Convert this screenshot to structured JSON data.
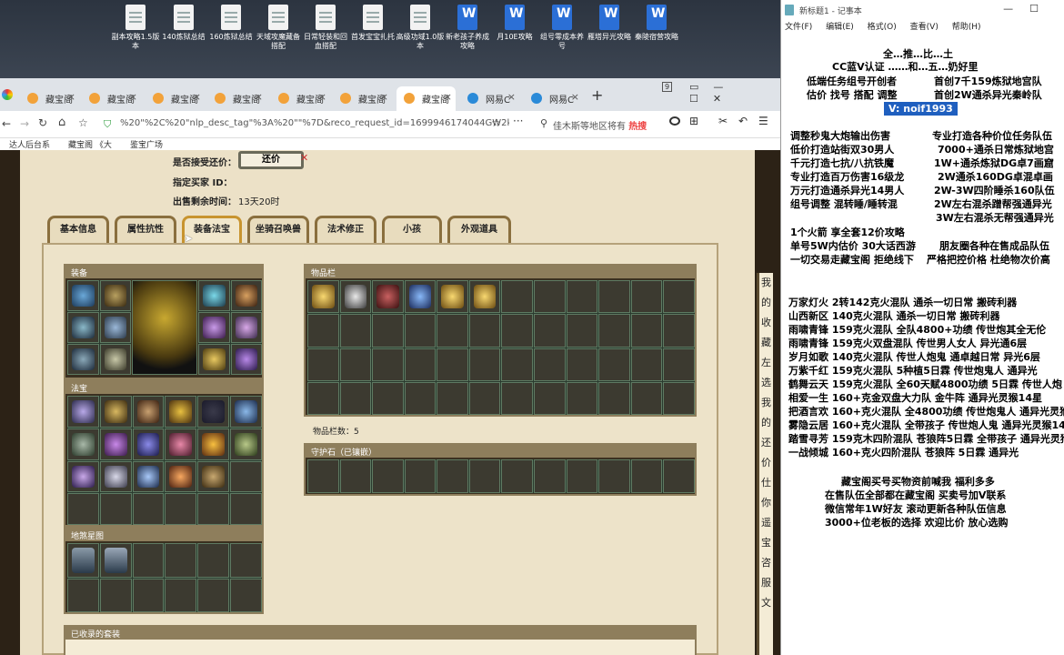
{
  "desktop": {
    "icons": [
      {
        "label": "副本攻略1.5版本",
        "type": "doc"
      },
      {
        "label": "140炼狱总结",
        "type": "doc"
      },
      {
        "label": "160炼狱总结",
        "type": "doc"
      },
      {
        "label": "天域攻魔藏备搭配",
        "type": "doc"
      },
      {
        "label": "日常轻装和回血搭配",
        "type": "doc"
      },
      {
        "label": "首发宝宝扎托",
        "type": "doc"
      },
      {
        "label": "高级功域1.0版本",
        "type": "doc"
      },
      {
        "label": "新老孩子养成攻略",
        "type": "word"
      },
      {
        "label": "月10E攻略",
        "type": "word"
      },
      {
        "label": "组号零成本养号",
        "type": "word"
      },
      {
        "label": "雁塔异光攻略",
        "type": "word"
      },
      {
        "label": "秦陵宿营攻略",
        "type": "word"
      }
    ]
  },
  "browser": {
    "tabs": [
      {
        "label": "藏宝阁"
      },
      {
        "label": "藏宝阁"
      },
      {
        "label": "藏宝阁"
      },
      {
        "label": "藏宝阁"
      },
      {
        "label": "藏宝阁"
      },
      {
        "label": "藏宝阁"
      },
      {
        "label": "藏宝阁",
        "active": true
      },
      {
        "label": "网易C"
      },
      {
        "label": "网易C"
      }
    ],
    "tab_count": "9",
    "url": "%20\"%2C%20\"nlp_desc_tag\"%3A%20\"\"%7D&reco_request_id=1699946174044GW2kd",
    "search_text": "佳木斯等地区将有",
    "search_hot": "热搜",
    "bookmarks": [
      "达人后台系",
      "藏宝阁 《大",
      "鉴宝广场"
    ]
  },
  "game": {
    "accept_price_label": "是否接受还价：",
    "accept_price_button": "还价",
    "buyer_id_label": "指定买家 ID：",
    "time_left_label": "出售剩余时间：",
    "time_left_value": "13天20时",
    "tabs": [
      "基本信息",
      "属性抗性",
      "装备法宝",
      "坐骑召唤兽",
      "法术修正",
      "小孩",
      "外观道具"
    ],
    "active_tab": "装备法宝",
    "sections": {
      "equipment": "装备",
      "fabao": "法宝",
      "dishafabao": "地煞星图",
      "inventory": "物品栏",
      "guardian": "守护石（已镶嵌）",
      "collected": "已收录的套装"
    },
    "item_count_label": "物品栏数：5",
    "right_strip": [
      "我",
      "的",
      "收",
      "藏",
      "左",
      "选",
      "我",
      "的",
      "还",
      "价",
      "仕",
      "你",
      "遥",
      "宝",
      "咨",
      "服",
      "文"
    ]
  },
  "notepad": {
    "title": "新标题1 - 记事本",
    "menu": [
      "文件(F)",
      "编辑(E)",
      "格式(O)",
      "查看(V)",
      "帮助(H)"
    ],
    "lines": [
      {
        "text": "全…推…比…土",
        "selected": false
      },
      {
        "text": "CC蓝V认证 ……和…五…奶好里",
        "selected": false
      },
      {
        "text": "低端任务组号开创者",
        "selected": false
      },
      {
        "text": "首创7千159炼狱地宫队",
        "selected": false
      },
      {
        "text": "估价 找号 搭配 调整",
        "selected": false
      },
      {
        "text": "首创2W通杀异光秦岭队",
        "selected": false
      },
      {
        "text": "V: noif1993",
        "selected": true
      },
      {
        "text": "调整秒鬼大炮输出伤害",
        "selected": false
      },
      {
        "text": "专业打造各种价位任务队伍",
        "selected": false
      },
      {
        "text": "低价打造站街双30男人",
        "selected": false
      },
      {
        "text": "7000+通杀日常炼狱地宫",
        "selected": false
      },
      {
        "text": "千元打造七抗/八抗铁魔",
        "selected": false
      },
      {
        "text": "1W+通杀炼狱DG卓7画窟",
        "selected": false
      },
      {
        "text": "专业打造百万伤害16级龙",
        "selected": false
      },
      {
        "text": "2W通杀160DG卓混卓画",
        "selected": false
      },
      {
        "text": "万元打造通杀异光14男人",
        "selected": false
      },
      {
        "text": "2W-3W四阶睡杀160队伍",
        "selected": false
      },
      {
        "text": "组号调整 混转睡/睡转混",
        "selected": false
      },
      {
        "text": "2W左右混杀蹭帮强通异光",
        "selected": false
      },
      {
        "text": "3W左右混杀无帮强通异光",
        "selected": false
      },
      {
        "text": "1个火箭 享全套12价攻略",
        "selected": false
      },
      {
        "text": "单号5W内估价 30大话西游",
        "selected": false
      },
      {
        "text": "朋友圈各种在售成品队伍",
        "selected": false
      },
      {
        "text": "一切交易走藏宝阁 拒绝线下",
        "selected": false
      },
      {
        "text": "严格把控价格 杜绝物次价高",
        "selected": false
      },
      {
        "text": "万家灯火 2转142克火混队 通杀一切日常 搬砖利器",
        "selected": false
      },
      {
        "text": "山西新区 140克火混队 通杀一切日常 搬砖利器",
        "selected": false
      },
      {
        "text": "雨啸青锋 159克火混队 全队4800+功绩 传世炮其全无伦",
        "selected": false
      },
      {
        "text": "雨啸青锋 159克火双盘混队 传世男人女人 异光通6层",
        "selected": false
      },
      {
        "text": "岁月如歌 140克火混队 传世人炮鬼 通卓越日常 异光6层",
        "selected": false
      },
      {
        "text": "万紫千红 159克火混队 5种植5日霖 传世炮鬼人 通异光",
        "selected": false
      },
      {
        "text": "鹤舞云天 159克火混队 全60天赋4800功绩 5日霖 传世人炮",
        "selected": false
      },
      {
        "text": "相爱一生 160+克金双盘大力队 金牛阵 通异光灵猴14星",
        "selected": false
      },
      {
        "text": "把酒言欢 160+克火混队 全4800功绩 传世炮鬼人 通异光灵猴",
        "selected": false
      },
      {
        "text": "雾隐云居 160+克火混队 全带孩子 传世炮人鬼 通异光灵猴14",
        "selected": false
      },
      {
        "text": "踏雪寻芳 159克木四阶混队 苍狼阵5日霖 全带孩子 通异光灵猴",
        "selected": false
      },
      {
        "text": "一战倾城 160+克火四阶混队 苍狼阵 5日霖 通异光",
        "selected": false
      },
      {
        "text": "藏宝阁买号买物资前喊我 福利多多",
        "selected": false
      },
      {
        "text": "在售队伍全部都在藏宝阁 买卖号加V联系",
        "selected": false
      },
      {
        "text": "微信常年1W好友 滚动更新各种队伍信息",
        "selected": false
      },
      {
        "text": "3000+位老板的选择 欢迎比价 放心选购",
        "selected": false
      }
    ]
  }
}
